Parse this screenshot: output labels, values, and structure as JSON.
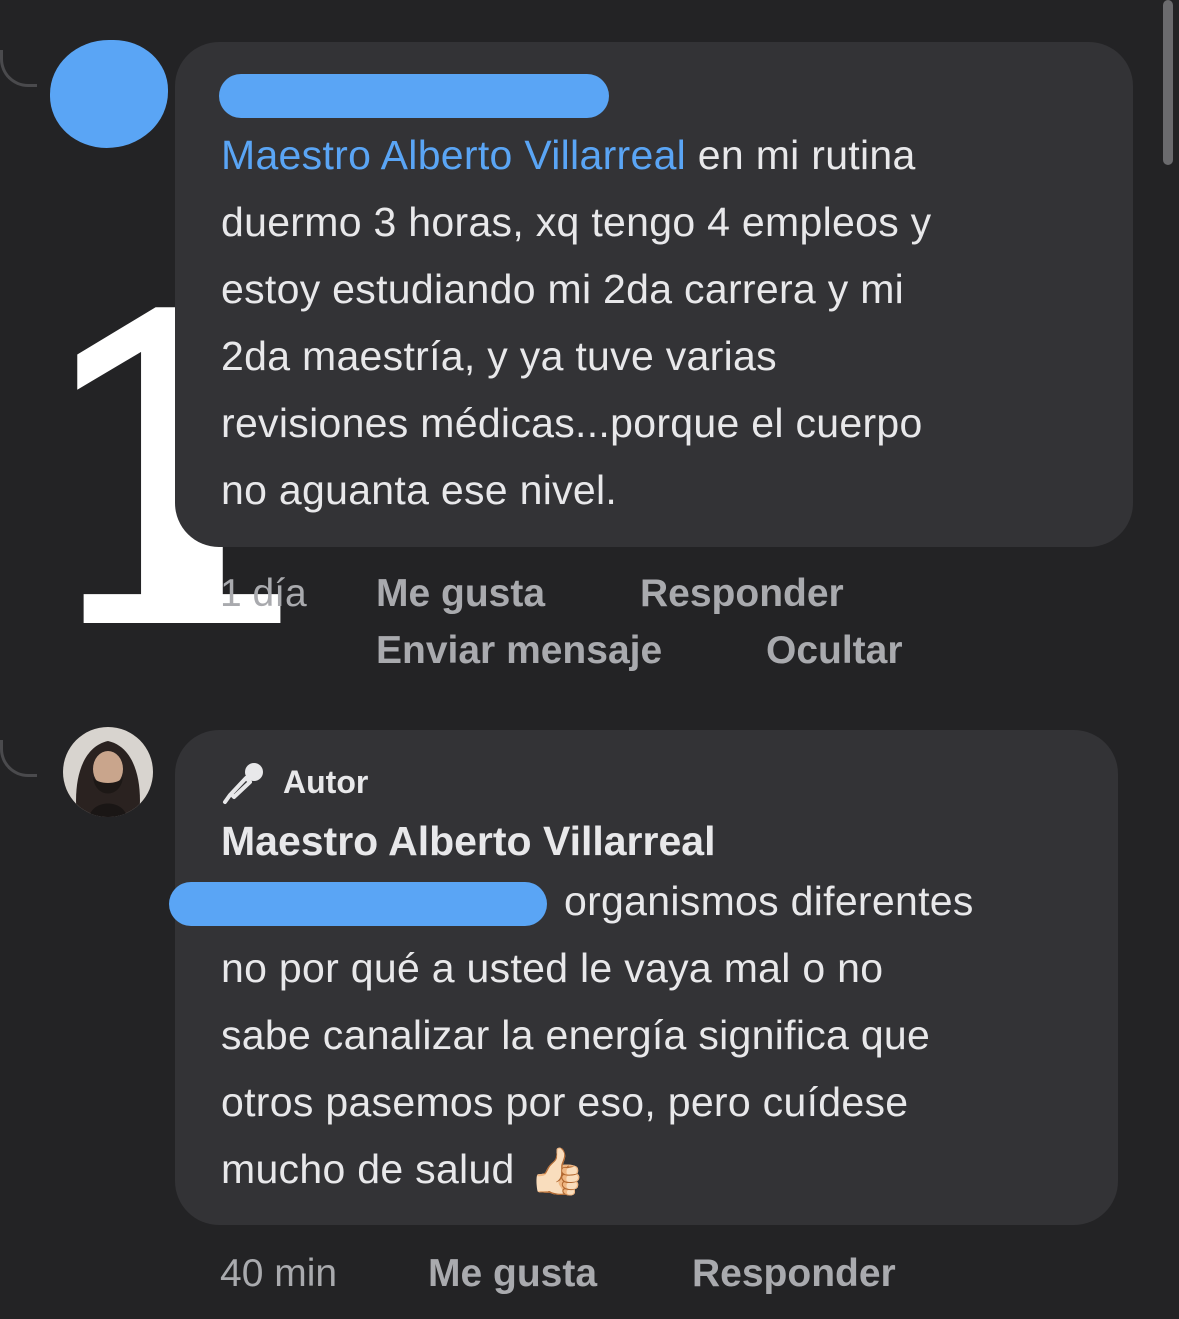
{
  "comment1": {
    "mention": "Maestro Alberto Villarreal",
    "lines": [
      "en mi rutina",
      "duermo 3 horas, xq tengo 4 empleos y",
      "estoy estudiando mi 2da carrera y mi",
      "2da maestría, y ya tuve varias",
      "revisiones médicas...porque el cuerpo",
      "no aguanta ese nivel."
    ],
    "time": "1 día",
    "like_label": "Me gusta",
    "reply_label": "Responder",
    "message_label": "Enviar mensaje",
    "hide_label": "Ocultar"
  },
  "annotation": {
    "number": "1"
  },
  "comment2": {
    "badge_label": "Autor",
    "badge_icon": "microphone-icon",
    "author_name": "Maestro Alberto Villarreal",
    "lines": [
      "organismos diferentes",
      "no por qué a usted le vaya mal o no",
      "sabe canalizar la energía significa que",
      "otros pasemos por eso, pero cuídese",
      "mucho de salud"
    ],
    "emoji": "👍🏻",
    "time": "40 min",
    "like_label": "Me gusta",
    "reply_label": "Responder"
  },
  "colors": {
    "background": "#232325",
    "bubble": "#333336",
    "mention": "#5aa5f5",
    "redaction": "#5aa5f5"
  }
}
